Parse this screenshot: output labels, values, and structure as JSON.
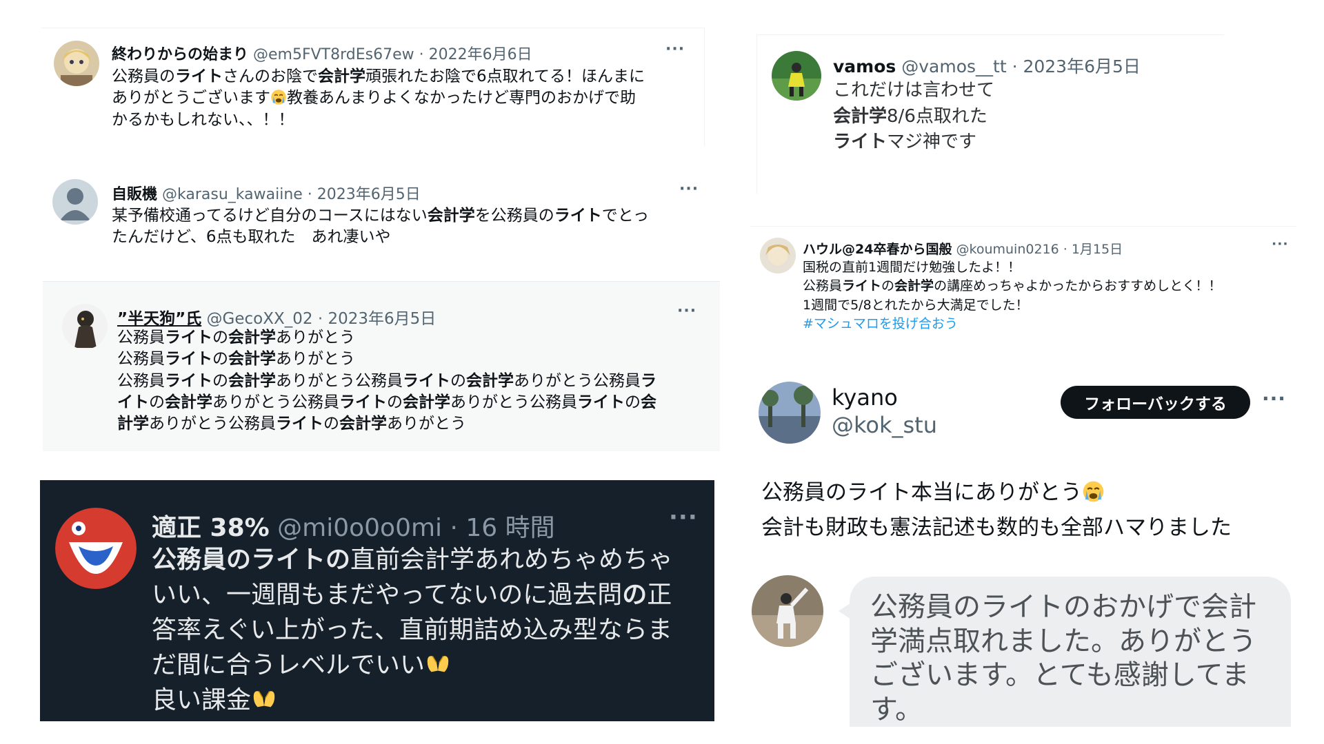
{
  "tweets": [
    {
      "name": "終わりからの始まり",
      "meta": "@em5FVT8rdEs67ew · 2022年6月6日",
      "more": "···",
      "lines": [
        [
          {
            "t": "公務員の"
          },
          {
            "t": "ライト",
            "b": true
          },
          {
            "t": "さんのお陰で"
          },
          {
            "t": "会計学",
            "b": true
          },
          {
            "t": "頑張れたお陰で6点取れてる！ほんまに"
          }
        ],
        [
          {
            "t": "ありがとうございます"
          },
          {
            "e": "crying-emoji"
          },
          {
            "t": "教養あんまりよくなかったけど専門のおかげで助"
          }
        ],
        [
          {
            "t": "かるかもしれない、、！！"
          }
        ]
      ]
    },
    {
      "name": "自販機",
      "meta": "@karasu_kawaiine · 2023年6月5日",
      "more": "···",
      "lines": [
        [
          {
            "t": "某予備校通ってるけど自分のコースにはない"
          },
          {
            "t": "会計学",
            "b": true
          },
          {
            "t": "を公務員の"
          },
          {
            "t": "ライト",
            "b": true
          },
          {
            "t": "でとっ"
          }
        ],
        [
          {
            "t": "たんだけど、6点も取れた　あれ凄いや"
          }
        ]
      ]
    },
    {
      "name": "”半天狗”氏",
      "meta": "@GecoXX_02 · 2023年6月5日",
      "more": "···",
      "lines": [
        [
          {
            "t": "公務員"
          },
          {
            "t": "ライト",
            "b": true
          },
          {
            "t": "の"
          },
          {
            "t": "会計学",
            "b": true
          },
          {
            "t": "ありがとう"
          }
        ],
        [
          {
            "t": "公務員"
          },
          {
            "t": "ライト",
            "b": true
          },
          {
            "t": "の"
          },
          {
            "t": "会計学",
            "b": true
          },
          {
            "t": "ありがとう"
          }
        ],
        [
          {
            "t": "公務員"
          },
          {
            "t": "ライト",
            "b": true
          },
          {
            "t": "の"
          },
          {
            "t": "会計学",
            "b": true
          },
          {
            "t": "ありがとう公務員"
          },
          {
            "t": "ライト",
            "b": true
          },
          {
            "t": "の"
          },
          {
            "t": "会計学",
            "b": true
          },
          {
            "t": "ありがとう公務員"
          },
          {
            "t": "ラ",
            "b": true
          }
        ],
        [
          {
            "t": "イト",
            "b": true
          },
          {
            "t": "の"
          },
          {
            "t": "会計学",
            "b": true
          },
          {
            "t": "ありがとう公務員"
          },
          {
            "t": "ライト",
            "b": true
          },
          {
            "t": "の"
          },
          {
            "t": "会計学",
            "b": true
          },
          {
            "t": "ありがとう公務員"
          },
          {
            "t": "ライト",
            "b": true
          },
          {
            "t": "の"
          },
          {
            "t": "会",
            "b": true
          }
        ],
        [
          {
            "t": "計学",
            "b": true
          },
          {
            "t": "ありがとう公務員"
          },
          {
            "t": "ライト",
            "b": true
          },
          {
            "t": "の"
          },
          {
            "t": "会計学",
            "b": true
          },
          {
            "t": "ありがとう"
          }
        ]
      ]
    },
    {
      "name": "適正 38%",
      "meta": "@mi0o0o0mi · 16 時間",
      "more": "···",
      "lines": [
        [
          {
            "t": "公務員のライトの",
            "b": true
          },
          {
            "t": "直前会計学あれめちゃめちゃ"
          }
        ],
        [
          {
            "t": "いい、一週間もまだやってないのに過去問"
          },
          {
            "t": "の",
            "b": true
          },
          {
            "t": "正"
          }
        ],
        [
          {
            "t": "答率えぐい上がった、直前期詰め込み型ならま"
          }
        ],
        [
          {
            "t": "だ間に合うレベルでいい"
          },
          {
            "e": "heart-hands-emoji"
          }
        ],
        [
          {
            "t": "良い課金"
          },
          {
            "e": "heart-hands-emoji"
          }
        ]
      ]
    },
    {
      "name": "vamos",
      "meta": "@vamos__tt · 2023年6月5日",
      "lines": [
        [
          {
            "t": "これだけは言わせて"
          }
        ],
        [
          {
            "t": "会計学",
            "b": true
          },
          {
            "t": "8/6点取れた"
          }
        ],
        [
          {
            "t": " "
          }
        ],
        [
          {
            "t": "ライト",
            "b": true
          },
          {
            "t": "マジ神です"
          }
        ]
      ]
    },
    {
      "name": "ハウル@24卒春から国般",
      "meta": "@koumuin0216 · 1月15日",
      "more": "···",
      "lines": [
        [
          {
            "t": "国税の直前1週間だけ勉強したよ！！"
          }
        ],
        [
          {
            "t": "公務員"
          },
          {
            "t": "ライト",
            "b": true
          },
          {
            "t": "の"
          },
          {
            "t": "会計学",
            "b": true
          },
          {
            "t": "の講座めっちゃよかったからおすすめしとく！！"
          }
        ],
        [
          {
            "t": "1週間で5/8とれたから大満足でした！"
          }
        ],
        [
          {
            "t": "#マシュマロを投げ合おう",
            "tag": true
          }
        ]
      ]
    }
  ],
  "profile": {
    "name": "kyano",
    "handle": "@kok_stu",
    "follow_label": "フォローバックする",
    "more": "···",
    "lines": [
      [
        {
          "t": "公務員のライト本当にありがとう"
        },
        {
          "e": "crying-emoji"
        }
      ],
      [
        {
          "t": "会計も財政も憲法記述も数的も全部ハマりました"
        }
      ]
    ]
  },
  "chat": {
    "message": "公務員のライトのおかげで会計学満点取れました。ありがとうございます。とても感謝してます。"
  },
  "colors": {
    "link": "#1d9bf0",
    "dark_bg": "#15202b",
    "follow_bg": "#0f1419",
    "bubble_bg": "#eceef0"
  }
}
